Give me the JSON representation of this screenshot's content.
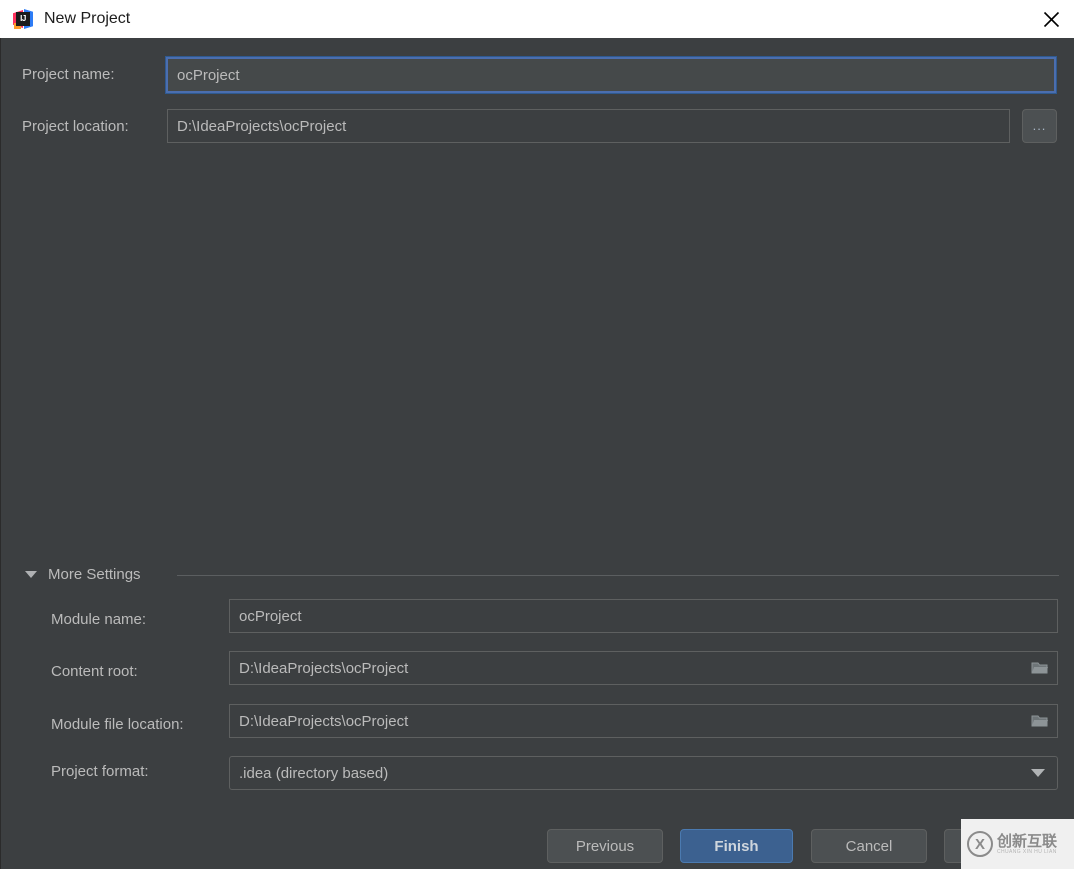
{
  "window": {
    "title": "New Project",
    "app_icon": "intellij-idea-icon",
    "app_icon_text": "IJ",
    "close_icon": "close-icon"
  },
  "form": {
    "project_name": {
      "label": "Project name:",
      "value": "ocProject",
      "focused": true
    },
    "project_location": {
      "label": "Project location:",
      "value": "D:\\IdeaProjects\\ocProject",
      "browse_label": "...",
      "browse_icon": "ellipsis-icon"
    }
  },
  "more_settings": {
    "label": "More Settings",
    "expanded": true,
    "toggle_icon": "chevron-down-icon",
    "module_name": {
      "label": "Module name:",
      "value": "ocProject"
    },
    "content_root": {
      "label": "Content root:",
      "value": "D:\\IdeaProjects\\ocProject",
      "browse_icon": "folder-icon"
    },
    "module_file_location": {
      "label": "Module file location:",
      "value": "D:\\IdeaProjects\\ocProject",
      "browse_icon": "folder-icon"
    },
    "project_format": {
      "label": "Project format:",
      "value": ".idea (directory based)",
      "dropdown_icon": "chevron-down-icon",
      "options": [
        ".idea (directory based)"
      ]
    }
  },
  "buttons": {
    "previous": "Previous",
    "finish": "Finish",
    "cancel": "Cancel",
    "help": ""
  },
  "watermark": {
    "mark": "X",
    "cn": "创新互联",
    "pinyin": "CHUANG XIN HU LIAN"
  },
  "colors": {
    "background": "#3c3f41",
    "titlebar": "#ffffff",
    "accent": "#3c6190",
    "focus_border": "#4b6eaf",
    "text": "#bbbbbb",
    "field_bg": "#45494a"
  }
}
